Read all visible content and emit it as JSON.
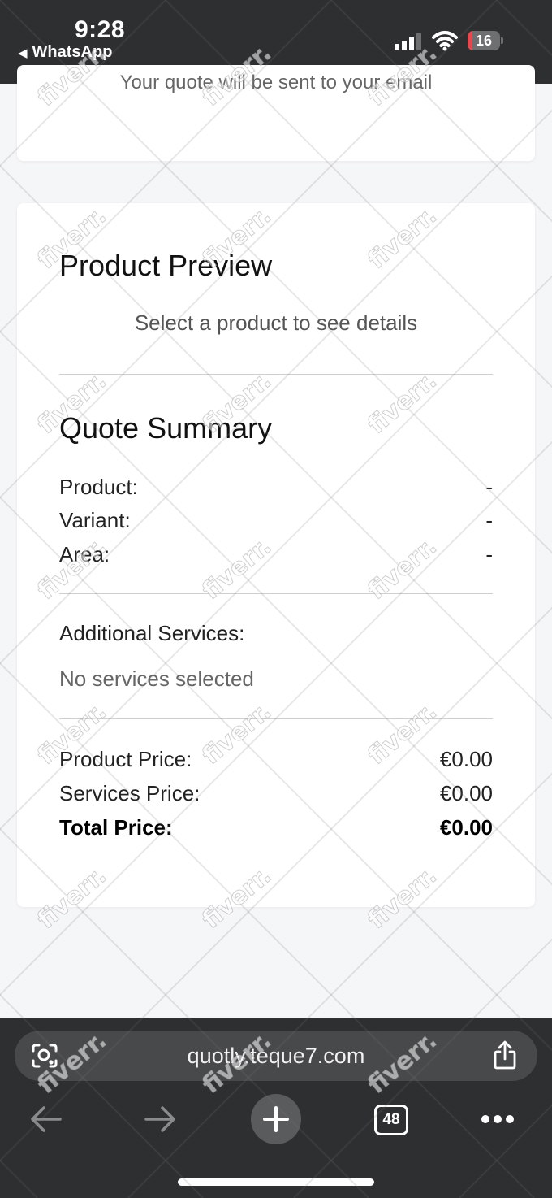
{
  "status_bar": {
    "time": "9:28",
    "back_app": "WhatsApp",
    "battery_level": "16",
    "battery_fraction": 0.16,
    "battery_color": "#e5484d"
  },
  "page": {
    "top_card_text": "Your quote will be sent to your email",
    "product_preview": {
      "title": "Product Preview",
      "hint": "Select a product to see details"
    },
    "quote_summary": {
      "title": "Quote Summary",
      "product_label": "Product:",
      "product_value": "-",
      "variant_label": "Variant:",
      "variant_value": "-",
      "area_label": "Area:",
      "area_value": "-",
      "services_label": "Additional Services:",
      "services_empty": "No services selected",
      "product_price_label": "Product Price:",
      "product_price_value": "€0.00",
      "services_price_label": "Services Price:",
      "services_price_value": "€0.00",
      "total_price_label": "Total Price:",
      "total_price_value": "€0.00"
    }
  },
  "browser": {
    "url": "quotly.teque7.com",
    "tab_count": "48"
  },
  "watermark_text": "fiverr."
}
